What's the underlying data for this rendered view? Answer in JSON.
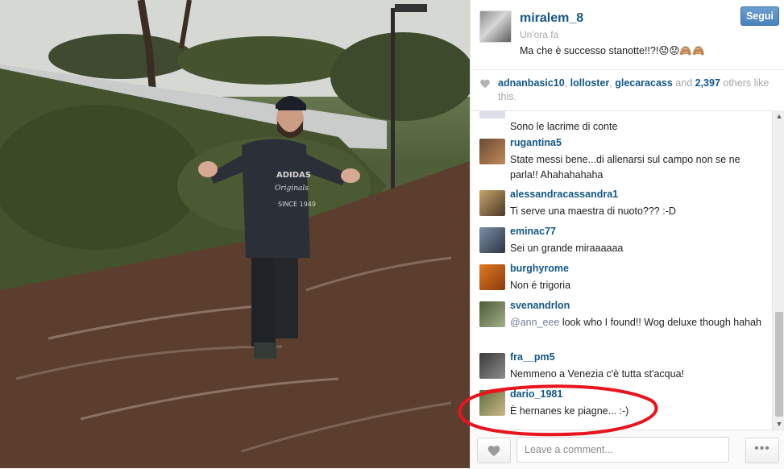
{
  "post": {
    "username": "miralem_8",
    "time_ago": "Un'ora fa",
    "caption": "Ma che è successo stanotte!!?!😟😟🙈🙈",
    "follow_label": "Segui"
  },
  "likes": {
    "user1": "adnanbasic10",
    "user2": "lolloster",
    "user3": "glecaracass",
    "and_text": " and ",
    "count": "2,397",
    "suffix": " others like this."
  },
  "comments": [
    {
      "user": "",
      "text": "Sono le lacrime di conte"
    },
    {
      "user": "rugantina5",
      "text": "State messi bene...di allenarsi sul campo non se ne parla!! Ahahahahaha"
    },
    {
      "user": "alessandracassandra1",
      "text": "Ti serve una maestra di nuoto??? :-D"
    },
    {
      "user": "eminac77",
      "text": "Sei un grande miraaaaaa"
    },
    {
      "user": "burghyrome",
      "text": "Non é trigoria"
    },
    {
      "user": "svenandrlon",
      "mention": "@ann_eee",
      "text": " look who I found!! Wog deluxe though hahah"
    },
    {
      "user": "fra__pm5",
      "text": "Nemmeno a Venezia c'è tutta st'acqua!"
    },
    {
      "user": "dario_1981",
      "text": "È hernanes ke piagne... :-)"
    }
  ],
  "footer": {
    "comment_placeholder": "Leave a comment...",
    "more_label": "•••"
  },
  "photo": {
    "sweater_text1": "ADIDAS",
    "sweater_text2": "Originals",
    "sweater_text3": "SINCE 1949"
  },
  "colors": {
    "link_blue": "#125688",
    "follow_blue": "#4a82bd",
    "highlight_red": "#e8141e"
  }
}
